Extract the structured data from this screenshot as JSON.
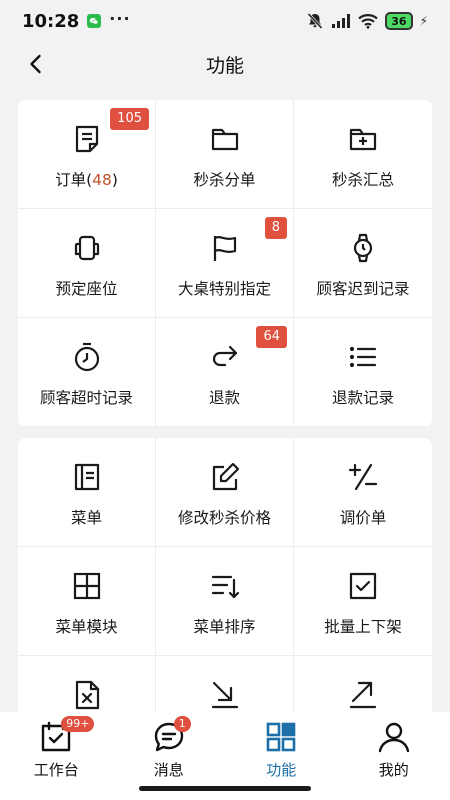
{
  "status_bar": {
    "time": "10:28",
    "more": "···",
    "battery": "36"
  },
  "header": {
    "title": "功能"
  },
  "section_1": [
    {
      "label": "订单(",
      "count": "48",
      "suffix": ")",
      "badge": "105",
      "icon": "order-icon"
    },
    {
      "label": "秒杀分单",
      "icon": "folder-icon"
    },
    {
      "label": "秒杀汇总",
      "icon": "folder-add-icon"
    },
    {
      "label": "预定座位",
      "icon": "seat-icon"
    },
    {
      "label": "大桌特别指定",
      "badge": "8",
      "icon": "flag-icon"
    },
    {
      "label": "顾客迟到记录",
      "icon": "watch-icon"
    },
    {
      "label": "顾客超时记录",
      "icon": "stopwatch-icon"
    },
    {
      "label": "退款",
      "badge": "64",
      "icon": "redo-arrow-icon"
    },
    {
      "label": "退款记录",
      "icon": "list-icon"
    }
  ],
  "section_2": [
    {
      "label": "菜单",
      "icon": "menu-book-icon"
    },
    {
      "label": "修改秒杀价格",
      "icon": "edit-icon"
    },
    {
      "label": "调价单",
      "icon": "plus-minus-icon"
    },
    {
      "label": "菜单模块",
      "icon": "grid-icon"
    },
    {
      "label": "菜单排序",
      "icon": "sort-icon"
    },
    {
      "label": "批量上下架",
      "icon": "checkbox-icon"
    },
    {
      "label": "",
      "icon": "file-x-icon"
    },
    {
      "label": "",
      "icon": "arrow-down-right-icon"
    },
    {
      "label": "",
      "icon": "arrow-up-right-icon"
    }
  ],
  "tab_bar": {
    "tabs": [
      {
        "label": "工作台",
        "badge": "99+",
        "icon": "workbench-icon"
      },
      {
        "label": "消息",
        "badge": "1",
        "icon": "message-icon"
      },
      {
        "label": "功能",
        "icon": "apps-icon",
        "active": true
      },
      {
        "label": "我的",
        "icon": "user-icon"
      }
    ]
  },
  "colors": {
    "accent": "#1c6fa8",
    "badge": "#e0503f",
    "count": "#c0532b"
  }
}
